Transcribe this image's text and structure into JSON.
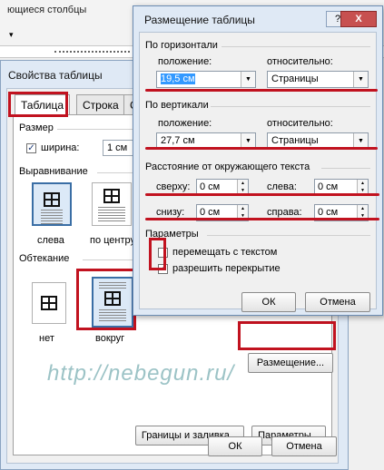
{
  "background": {
    "ribbon_fragment": "ющиеся столбцы"
  },
  "table_properties": {
    "title": "Свойства таблицы",
    "tabs": [
      {
        "label": "Таблица",
        "active": true
      },
      {
        "label": "Строка",
        "active": false
      },
      {
        "label": "С",
        "active": false
      }
    ],
    "size": {
      "group": "Размер",
      "width_checkbox": "ширина:",
      "width_checked": true,
      "width_value": "1 см"
    },
    "alignment": {
      "group": "Выравнивание",
      "options": [
        "слева",
        "по центру"
      ]
    },
    "wrapping": {
      "group": "Обтекание",
      "options": [
        "нет",
        "вокруг"
      ],
      "selected": "вокруг"
    },
    "buttons": {
      "positioning": "Размещение...",
      "borders": "Границы и заливка...",
      "options": "Параметры...",
      "ok": "ОК",
      "cancel": "Отмена"
    }
  },
  "positioning_dialog": {
    "title": "Размещение таблицы",
    "help": "?",
    "close": "X",
    "horizontal": {
      "group": "По горизонтали",
      "position_label": "положение:",
      "position_value": "19,5 см",
      "relative_label": "относительно:",
      "relative_value": "Страницы"
    },
    "vertical": {
      "group": "По вертикали",
      "position_label": "положение:",
      "position_value": "27,7 см",
      "relative_label": "относительно:",
      "relative_value": "Страницы"
    },
    "distance": {
      "group": "Расстояние от окружающего текста",
      "top_label": "сверху:",
      "top_value": "0 см",
      "left_label": "слева:",
      "left_value": "0 см",
      "bottom_label": "снизу:",
      "bottom_value": "0 см",
      "right_label": "справа:",
      "right_value": "0 см"
    },
    "parameters": {
      "group": "Параметры",
      "move_with_text": "перемещать с текстом",
      "move_with_text_checked": false,
      "allow_overlap": "разрешить перекрытие",
      "allow_overlap_checked": true
    },
    "buttons": {
      "ok": "ОК",
      "cancel": "Отмена"
    }
  },
  "watermark": "http://nebegun.ru/",
  "colors": {
    "annotation_red": "#c1121f",
    "selection_blue": "#3399ff"
  }
}
